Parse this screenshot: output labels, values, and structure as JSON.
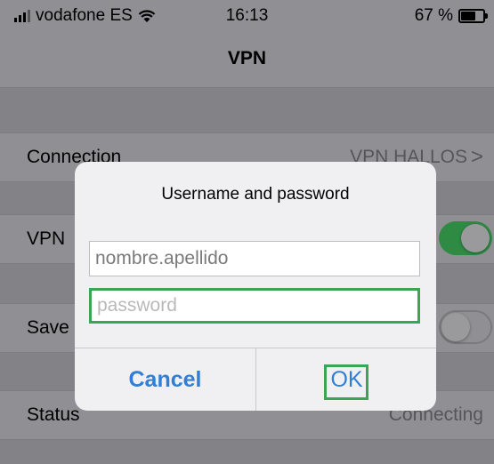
{
  "status_bar": {
    "carrier": "vodafone ES",
    "time": "16:13",
    "battery": "67 %",
    "icons": [
      "signal-icon",
      "wifi-icon",
      "battery-icon"
    ]
  },
  "nav": {
    "title": "VPN"
  },
  "settings": {
    "connection": {
      "label": "Connection",
      "value": "VPN HALLOS",
      "chevron": ">"
    },
    "vpn": {
      "label": "VPN",
      "toggle": "on"
    },
    "save": {
      "label": "Save",
      "toggle": "off"
    },
    "status": {
      "label": "Status",
      "value": "Connecting"
    }
  },
  "dialog": {
    "title": "Username and password",
    "username_value": "nombre.apellido",
    "password_placeholder": "password",
    "cancel_label": "Cancel",
    "ok_label": "OK"
  },
  "colors": {
    "accent": "#2f7fd6",
    "highlight": "#3aa655",
    "toggle_on": "#2f8a44"
  }
}
